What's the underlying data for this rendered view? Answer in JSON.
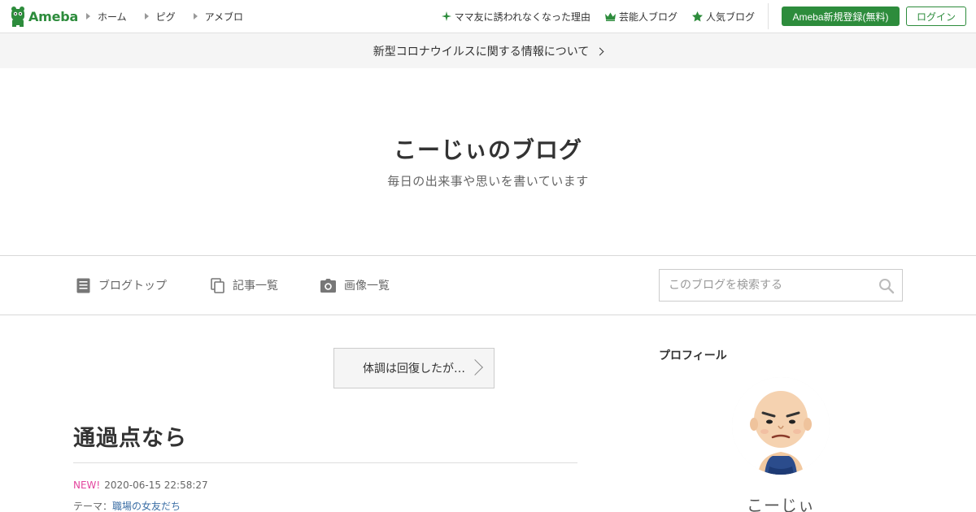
{
  "header": {
    "logo_text": "Ameba",
    "nav": [
      {
        "label": "ホーム"
      },
      {
        "label": "ピグ"
      },
      {
        "label": "アメブロ"
      }
    ],
    "right_links": [
      {
        "label": "ママ友に誘われなくなった理由",
        "icon": "sparkle-icon"
      },
      {
        "label": "芸能人ブログ",
        "icon": "crown-icon"
      },
      {
        "label": "人気ブログ",
        "icon": "star-icon"
      }
    ],
    "register_label": "Ameba新規登録(無料)",
    "login_label": "ログイン"
  },
  "notice": {
    "text": "新型コロナウイルスに関する情報について"
  },
  "blog": {
    "title": "こーじぃのブログ",
    "description": "毎日の出来事や思いを書いています"
  },
  "blog_nav": {
    "items": [
      {
        "label": "ブログトップ",
        "icon": "document-icon"
      },
      {
        "label": "記事一覧",
        "icon": "copy-icon"
      },
      {
        "label": "画像一覧",
        "icon": "camera-icon"
      }
    ],
    "search_placeholder": "このブログを検索する"
  },
  "entry": {
    "prev_label": "体調は回復したが…",
    "title": "通過点なら",
    "new_badge": "NEW!",
    "datetime": "2020-06-15 22:58:27",
    "theme_prefix": "テーマ：",
    "theme": "職場の女友だち"
  },
  "sidebar": {
    "heading": "プロフィール",
    "name": "こーじぃ"
  },
  "colors": {
    "brand": "#2d8c3c",
    "new_badge": "#e3459e",
    "link": "#3b6ea5"
  }
}
